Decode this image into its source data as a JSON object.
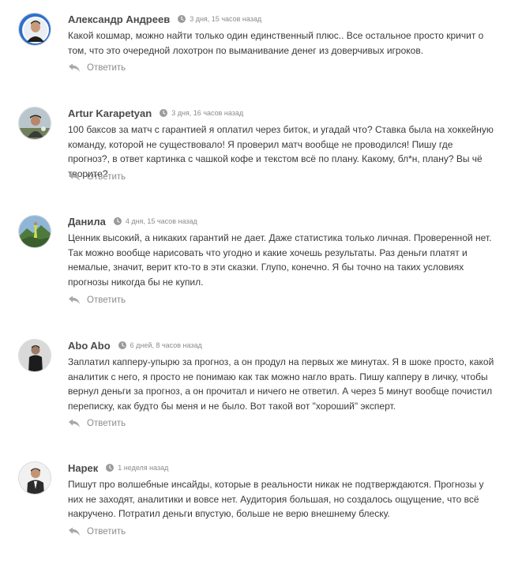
{
  "comments": [
    {
      "author": "Александр Андреев",
      "time": "3 дня, 15 часов назад",
      "text": "Какой кошмар, можно найти только один единственный плюс.. Все остальное просто кричит о том, что это очередной лохотрон по выманивание денег из доверчивых игроков.",
      "reply": "Ответить",
      "avatar_icon": "user-avatar-icon"
    },
    {
      "author": "Artur Karapetyan",
      "time": "3 дня, 16 часов назад",
      "text": "100 баксов за матч с гарантией я оплатил через биток, и угадай что? Ставка была на хоккейную команду, которой не существовало! Я проверил матч вообще не проводился! Пишу где прогноз?, в ответ картинка с чашкой кофе и текстом всё по плану. Какому, бл*н, плану? Вы чё творите?",
      "reply": "Ответить",
      "avatar_icon": "user-avatar-icon"
    },
    {
      "author": "Данила",
      "time": "4 дня, 15 часов назад",
      "text": "Ценник высокий, а никаких гарантий не дает. Даже статистика только личная. Проверенной нет. Так можно вообще нарисовать что угодно и какие хочешь результаты. Раз деньги платят и немалые, значит, верит кто-то в эти сказки. Глупо, конечно. Я бы точно на таких условиях прогнозы никогда бы не купил.",
      "reply": "Ответить",
      "avatar_icon": "user-avatar-icon"
    },
    {
      "author": "Abo Abo",
      "time": "6 дней, 8 часов назад",
      "text": "Заплатил капперу-упырю за прогноз, а он продул на первых же минутах. Я в шоке просто, какой аналитик с него, я просто не понимаю как так можно нагло врать. Пишу капперу в личку, чтобы вернул деньги за прогноз, а он прочитал и ничего не ответил. А через 5 минут вообще почистил переписку, как будто бы меня и не было. Вот такой вот \"хороший\" эксперт.",
      "reply": "Ответить",
      "avatar_icon": "user-avatar-icon"
    },
    {
      "author": "Нарек",
      "time": "1 неделя назад",
      "text": "Пишут про волшебные инсайды, которые в реальности никак не подтверждаются. Прогнозы у них не заходят, аналитики и вовсе нет. Аудитория большая, но создалось ощущение, что всё накручено. Потратил деньги впустую, больше не верю внешнему блеску.",
      "reply": "Ответить",
      "avatar_icon": "user-avatar-icon"
    }
  ],
  "colors": {
    "author": "#4a4a4a",
    "text": "#3a3a3a",
    "muted": "#8c8c8c"
  }
}
